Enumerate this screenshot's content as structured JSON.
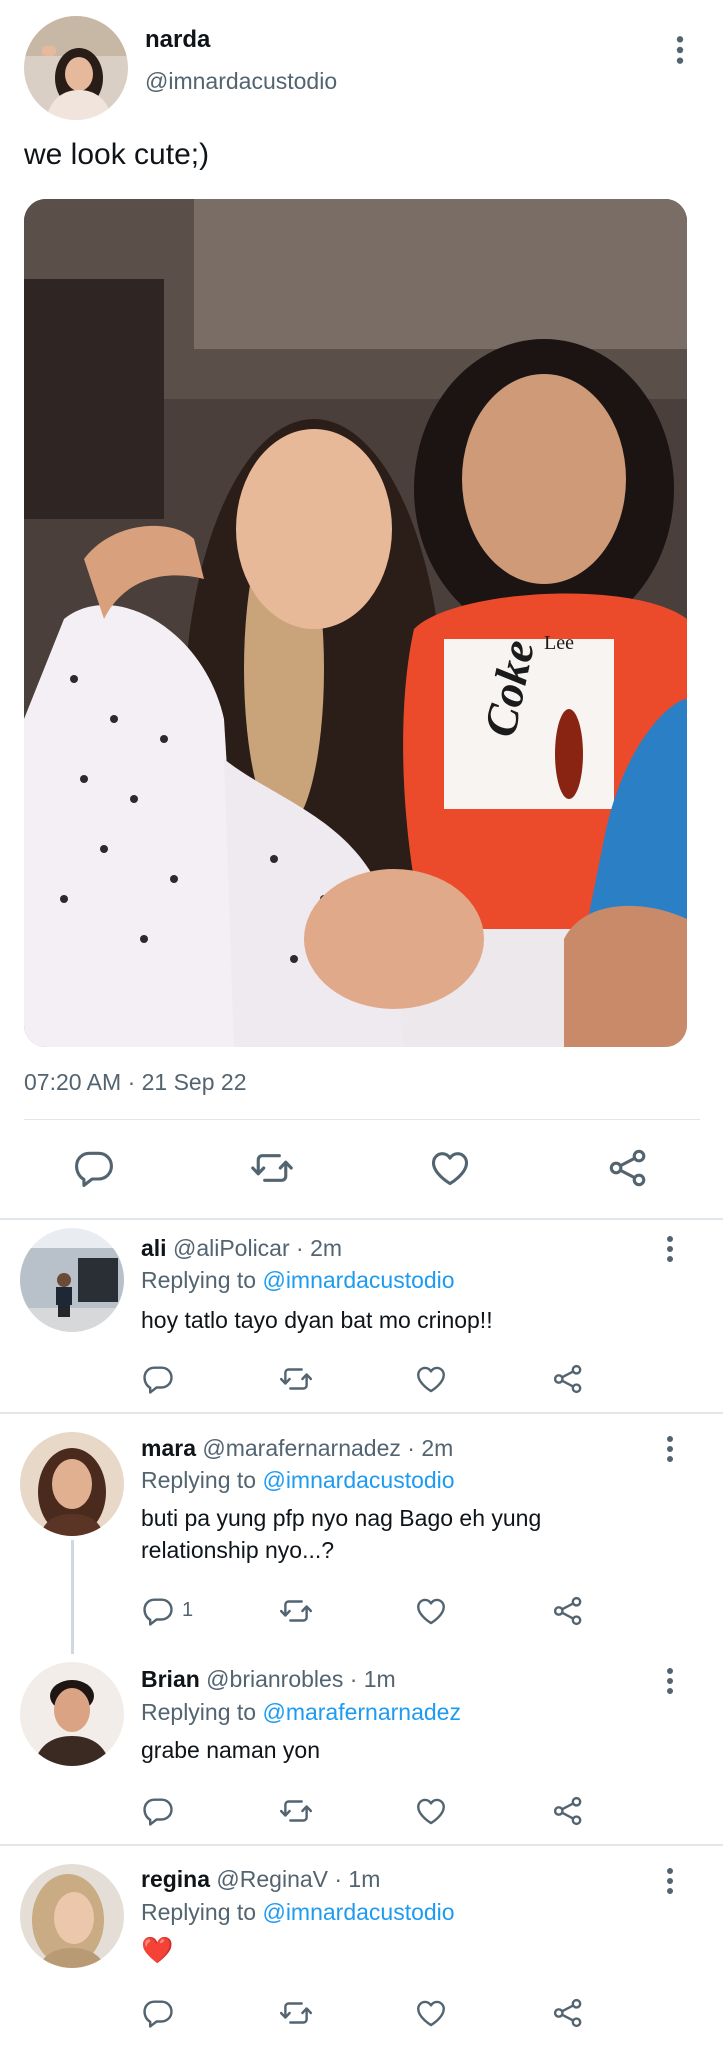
{
  "main_tweet": {
    "name": "narda",
    "handle": "@imnardacustodio",
    "text": "we look cute;)",
    "timestamp": "07:20 AM · 21 Sep 22",
    "photo_text": {
      "shirt_brand": "Lee",
      "shirt_logo": "Coke"
    }
  },
  "replies": [
    {
      "name": "ali",
      "meta": " @aliPolicar · 2m",
      "replying_label": "Replying to ",
      "replying_to": "@imnardacustodio",
      "text": "hoy tatlo tayo dyan bat mo crinop!!"
    },
    {
      "name": "mara",
      "meta": " @marafernarnadez · 2m",
      "replying_label": "Replying to ",
      "replying_to": "@imnardacustodio",
      "text": "buti pa yung pfp nyo nag Bago eh yung relationship nyo...?",
      "reply_count": "1"
    },
    {
      "name": "Brian",
      "meta": "  @brianrobles · 1m",
      "replying_label": "Replying to ",
      "replying_to": "@marafernarnadez",
      "text": "grabe naman yon"
    },
    {
      "name": "regina",
      "meta": " @ReginaV · 1m",
      "replying_label": "Replying to ",
      "replying_to": "@imnardacustodio",
      "text": "❤️"
    }
  ],
  "icons": {
    "more": "more-vertical-icon",
    "reply": "reply-icon",
    "retweet": "retweet-icon",
    "like": "heart-icon",
    "share": "share-icon"
  },
  "colors": {
    "text": "#0f1419",
    "muted": "#536471",
    "link": "#1d9bf0",
    "divider": "#e1e6ea"
  }
}
